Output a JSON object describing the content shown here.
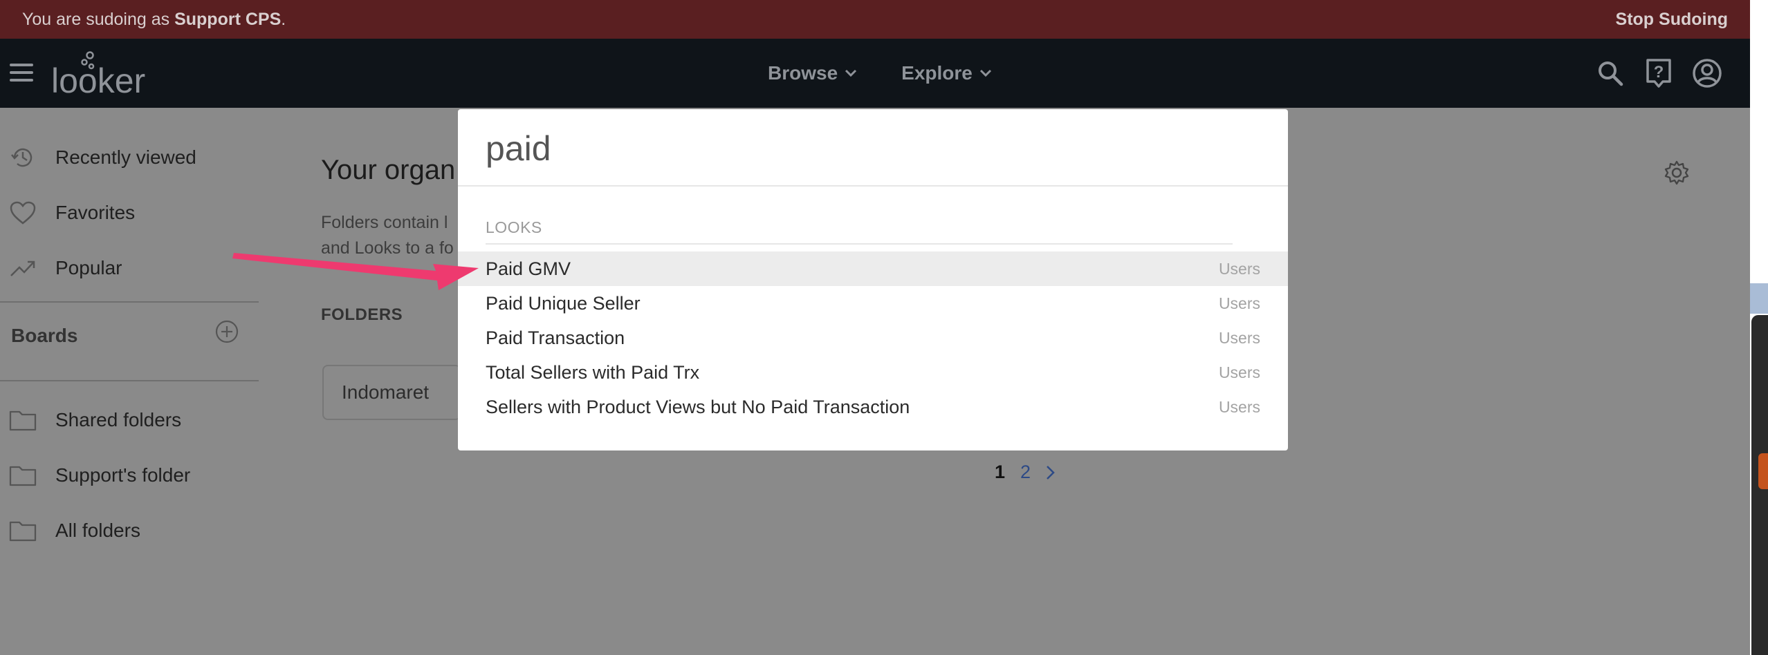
{
  "sudo_banner": {
    "prefix": "You are sudoing as ",
    "user": "Support CPS",
    "suffix": ".",
    "stop_label": "Stop Sudoing"
  },
  "topnav": {
    "logo_text": "looker",
    "menu": [
      {
        "label": "Browse"
      },
      {
        "label": "Explore"
      }
    ]
  },
  "sidebar": {
    "items": [
      {
        "label": "Recently viewed"
      },
      {
        "label": "Favorites"
      },
      {
        "label": "Popular"
      }
    ],
    "boards_label": "Boards",
    "folders": [
      {
        "label": "Shared folders"
      },
      {
        "label": "Support's folder"
      },
      {
        "label": "All folders"
      }
    ]
  },
  "main": {
    "title": "Your organ",
    "desc_line1": "Folders contain l",
    "desc_line2": "and Looks to a fo",
    "folders_heading": "FOLDERS",
    "folder_card": "Indomaret",
    "pagination": {
      "current": "1",
      "next_page": "2"
    }
  },
  "search": {
    "query": "paid",
    "section": "LOOKS",
    "results": [
      {
        "title": "Paid GMV",
        "category": "Users"
      },
      {
        "title": "Paid Unique Seller",
        "category": "Users"
      },
      {
        "title": "Paid Transaction",
        "category": "Users"
      },
      {
        "title": "Total Sellers with Paid Trx",
        "category": "Users"
      },
      {
        "title": "Sellers with Product Views but No Paid Transaction",
        "category": "Users"
      }
    ]
  },
  "colors": {
    "banner": "#5a1f21",
    "nav": "#0f1419",
    "overlay": "#8a8a8a",
    "annotation_arrow": "#ee3a6f"
  }
}
